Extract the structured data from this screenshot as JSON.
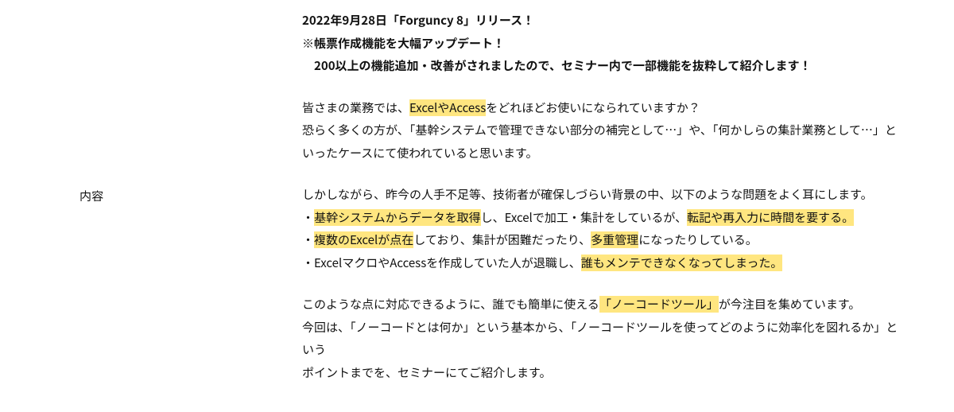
{
  "label": "内容",
  "intro": {
    "line1": "2022年9月28日「Forguncy 8」リリース！",
    "line2": "※帳票作成機能を大幅アップデート！",
    "line3": "200以上の機能追加・改善がされましたので、セミナー内で一部機能を抜粋して紹介します！"
  },
  "q": {
    "pre": "皆さまの業務では、",
    "hl": "ExcelやAccess",
    "post": "をどれほどお使いになられていますか？",
    "line2": "恐らく多くの方が、「基幹システムで管理できない部分の補完として…」や、「何かしらの集計業務として…」といったケースにて使われていると思います。"
  },
  "problems": {
    "lead": "しかしながら、昨今の人手不足等、技術者が確保しづらい背景の中、以下のような問題をよく耳にします。",
    "b1": {
      "pre": "・",
      "hl1": "基幹システムからデータを取得",
      "mid": "し、Excelで加工・集計をしているが、",
      "hl2": "転記や再入力に時間を要する。"
    },
    "b2": {
      "pre": "・",
      "hl1": "複数のExcelが点在",
      "mid1": "しており、集計が困難だったり、",
      "hl2": "多重管理",
      "mid2": "になったりしている。"
    },
    "b3": {
      "pre": "・ExcelマクロやAccessを作成していた人が退職し、",
      "hl": "誰もメンテできなくなってしまった。"
    }
  },
  "close": {
    "l1a": "このような点に対応できるように、誰でも簡単に使える",
    "l1hl": "「ノーコードツール」",
    "l1b": "が今注目を集めています。",
    "l2": "今回は、「ノーコードとは何か」という基本から、「ノーコードツールを使ってどのように効率化を図れるか」という",
    "l3": "ポイントまでを、セミナーにてご紹介します。"
  }
}
